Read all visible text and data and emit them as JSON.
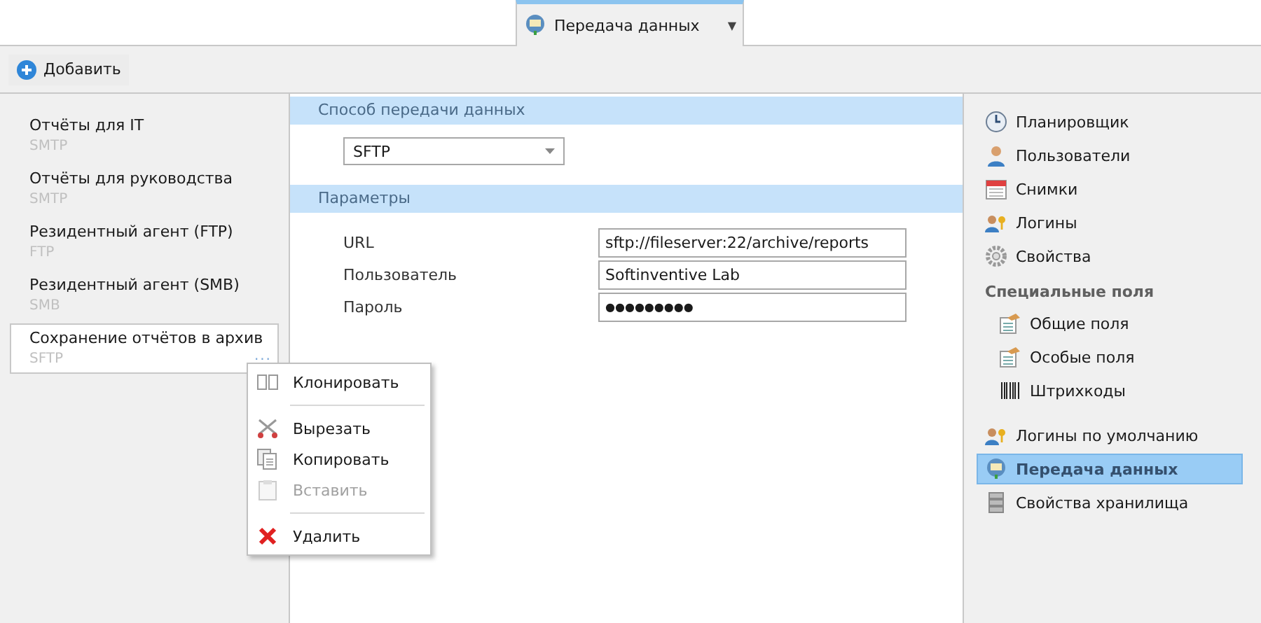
{
  "tab": {
    "label": "Передача данных",
    "selected": true,
    "caret": "▼"
  },
  "toolbar": {
    "add_button": "Добавить"
  },
  "connections": [
    {
      "name": "Отчёты для IT",
      "protocol": "SMTP",
      "selected": false
    },
    {
      "name": "Отчёты для руководства",
      "protocol": "SMTP",
      "selected": false
    },
    {
      "name": "Резидентный агент (FTP)",
      "protocol": "FTP",
      "selected": false
    },
    {
      "name": "Резидентный агент (SMB)",
      "protocol": "SMB",
      "selected": false
    },
    {
      "name": "Сохранение отчётов в архив",
      "protocol": "SFTP",
      "selected": true,
      "more": "..."
    }
  ],
  "context_menu": [
    [
      {
        "label": "Клонировать",
        "disabled": false
      }
    ],
    [
      {
        "label": "Вырезать",
        "disabled": false
      },
      {
        "label": "Копировать",
        "disabled": false
      },
      {
        "label": "Вставить",
        "disabled": true
      }
    ],
    [
      {
        "label": "Удалить",
        "disabled": false
      }
    ]
  ],
  "method_section": {
    "title": "Способ передачи данных",
    "value": "SFTP"
  },
  "params_section": {
    "title": "Параметры",
    "fields": [
      {
        "label": "URL",
        "value": "sftp://fileserver:22/archive/reports",
        "kind": "text"
      },
      {
        "label": "Пользователь",
        "value": "Softinventive Lab",
        "kind": "text"
      },
      {
        "label": "Пароль",
        "value": "●●●●●●●●●",
        "kind": "password"
      }
    ]
  },
  "nav": [
    {
      "kind": "item",
      "label": "Планировщик",
      "selected": false
    },
    {
      "kind": "item",
      "label": "Пользователи",
      "selected": false
    },
    {
      "kind": "item",
      "label": "Снимки",
      "selected": false
    },
    {
      "kind": "item",
      "label": "Логины",
      "selected": false
    },
    {
      "kind": "item",
      "label": "Свойства",
      "selected": false
    },
    {
      "kind": "header",
      "label": "Специальные поля"
    },
    {
      "kind": "subitem",
      "label": "Общие поля",
      "selected": false
    },
    {
      "kind": "subitem",
      "label": "Особые поля",
      "selected": false
    },
    {
      "kind": "subitem",
      "label": "Штрихкоды",
      "selected": false
    },
    {
      "kind": "gap"
    },
    {
      "kind": "item",
      "label": "Логины по умолчанию",
      "selected": false
    },
    {
      "kind": "item",
      "label": "Передача данных",
      "selected": true
    },
    {
      "kind": "item",
      "label": "Свойства хранилища",
      "selected": false
    }
  ]
}
